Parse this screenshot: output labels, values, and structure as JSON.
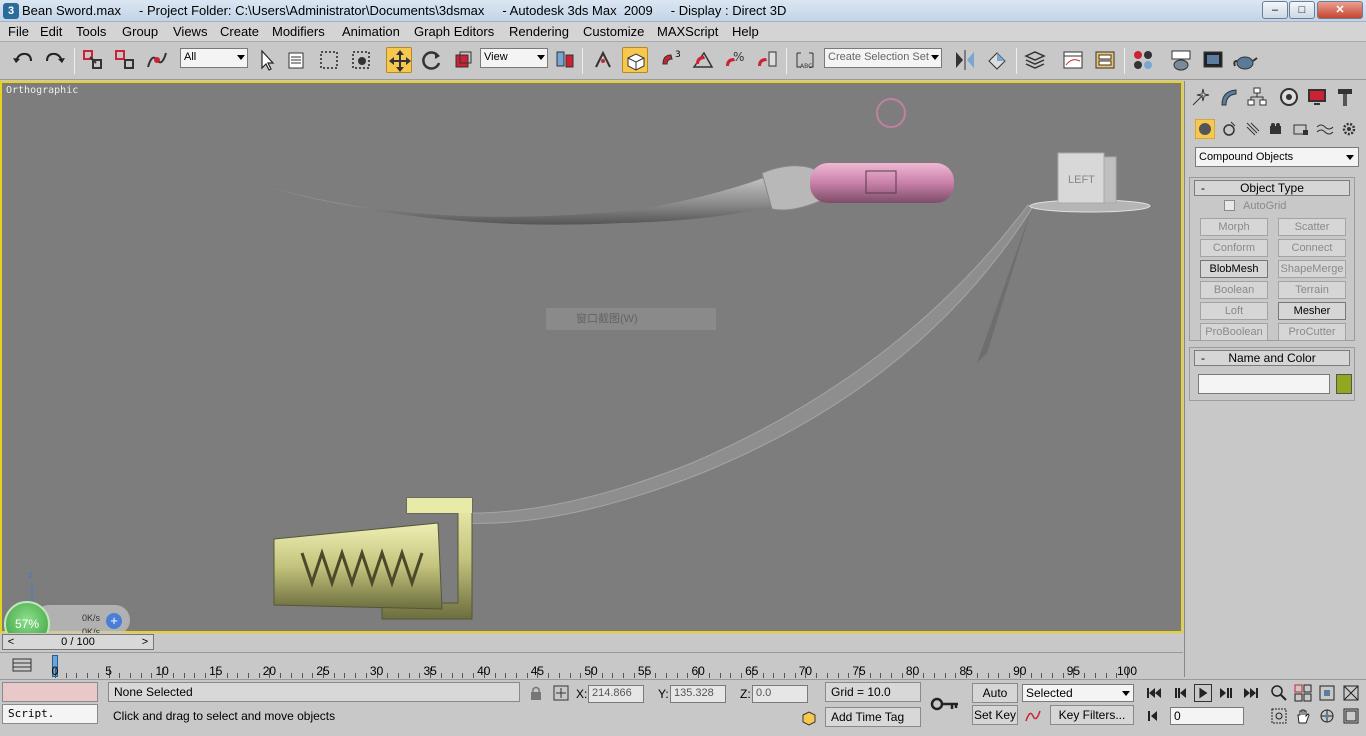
{
  "window": {
    "title": "Bean Sword.max     - Project Folder: C:\\Users\\Administrator\\Documents\\3dsmax     - Autodesk 3ds Max  2009     - Display : Direct 3D",
    "minimize": "–",
    "maximize": "□",
    "close": "✕"
  },
  "menu": [
    "File",
    "Edit",
    "Tools",
    "Group",
    "Views",
    "Create",
    "Modifiers",
    "Animation",
    "Graph Editors",
    "Rendering",
    "Customize",
    "MAXScript",
    "Help"
  ],
  "toolbar": {
    "selection_filter": "All",
    "reference_coord": "View",
    "named_selection_placeholder": "Create Selection Set",
    "snap_label": "3"
  },
  "viewport": {
    "label": "Orthographic",
    "ghost_menu_label": "窗口截图(W)",
    "viewcube_label": "LEFT",
    "active_border_color": "#e8d21f",
    "perf": {
      "percent": "57%",
      "up_rate": "0K/s",
      "down_rate": "0K/s",
      "plus": "+"
    }
  },
  "command_panel": {
    "category": "Compound Objects",
    "object_type_title": "Object Type",
    "autogrid_label": "AutoGrid",
    "buttons": [
      {
        "label": "Morph",
        "enabled": false
      },
      {
        "label": "Scatter",
        "enabled": false
      },
      {
        "label": "Conform",
        "enabled": false
      },
      {
        "label": "Connect",
        "enabled": false
      },
      {
        "label": "BlobMesh",
        "enabled": true
      },
      {
        "label": "ShapeMerge",
        "enabled": false
      },
      {
        "label": "Boolean",
        "enabled": false
      },
      {
        "label": "Terrain",
        "enabled": false
      },
      {
        "label": "Loft",
        "enabled": false
      },
      {
        "label": "Mesher",
        "enabled": true
      },
      {
        "label": "ProBoolean",
        "enabled": false
      },
      {
        "label": "ProCutter",
        "enabled": false
      }
    ],
    "name_color_title": "Name and Color",
    "object_name": "",
    "object_color": "#8fa81c",
    "rollout_toggle": "-"
  },
  "timeline": {
    "frame_display": "0 / 100",
    "prev": "<",
    "next": ">",
    "ticks": [
      "0",
      "5",
      "10",
      "15",
      "20",
      "25",
      "30",
      "35",
      "40",
      "45",
      "50",
      "55",
      "60",
      "65",
      "70",
      "75",
      "80",
      "85",
      "90",
      "95",
      "100"
    ]
  },
  "status": {
    "maxscript_label": "Script.",
    "selection_status": "None Selected",
    "prompt": "Click and drag to select and move objects",
    "x_label": "X:",
    "x_value": "214.866",
    "y_label": "Y:",
    "y_value": "135.328",
    "z_label": "Z:",
    "z_value": "0.0",
    "grid": "Grid = 10.0",
    "add_time_tag": "Add Time Tag",
    "auto_key": "Auto Key",
    "set_key": "Set Key",
    "key_mode": "Selected",
    "key_filters": "Key Filters...",
    "current_frame": "0"
  }
}
